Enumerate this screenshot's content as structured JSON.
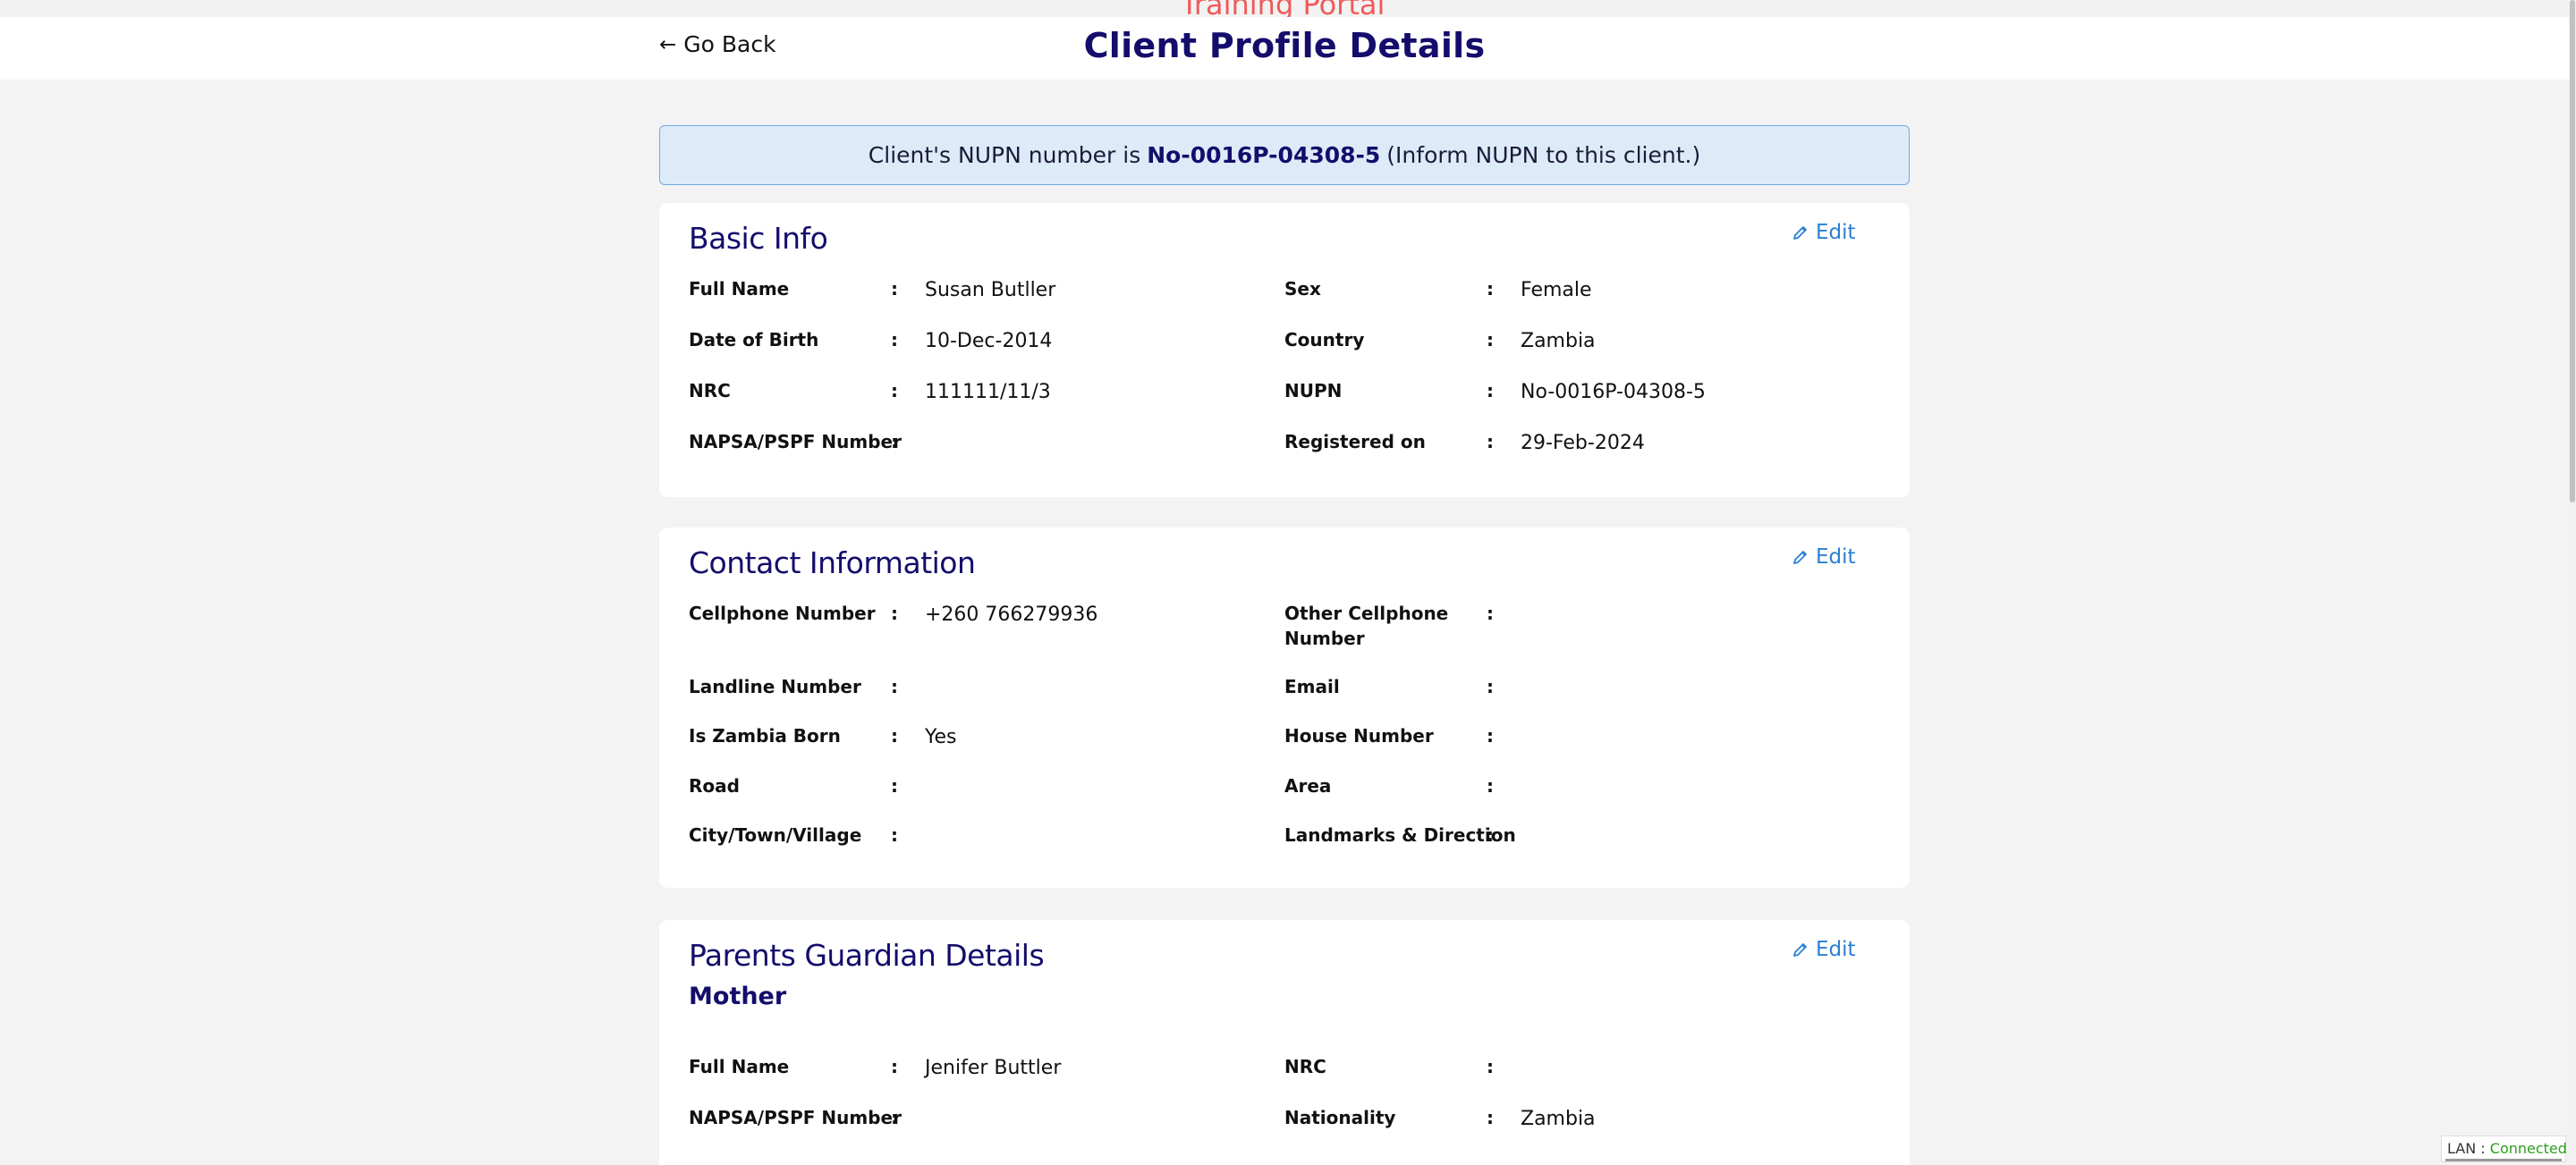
{
  "portal_banner": "Training Portal",
  "header": {
    "go_back": "Go Back",
    "title": "Client Profile Details"
  },
  "nupn_notice": {
    "prefix": "Client's NUPN number is",
    "number": "No-0016P-04308-5",
    "suffix": "(Inform NUPN to this client.)"
  },
  "basic_info": {
    "title": "Basic Info",
    "edit_label": "Edit",
    "fields": {
      "full_name": {
        "label": "Full Name",
        "value": "Susan Butller"
      },
      "sex": {
        "label": "Sex",
        "value": "Female"
      },
      "dob": {
        "label": "Date of Birth",
        "value": "10-Dec-2014"
      },
      "country": {
        "label": "Country",
        "value": "Zambia"
      },
      "nrc": {
        "label": "NRC",
        "value": "111111/11/3"
      },
      "nupn": {
        "label": "NUPN",
        "value": "No-0016P-04308-5"
      },
      "napsa": {
        "label": "NAPSA/PSPF Number",
        "value": ""
      },
      "registered": {
        "label": "Registered on",
        "value": "29-Feb-2024"
      }
    }
  },
  "contact_info": {
    "title": "Contact Information",
    "edit_label": "Edit",
    "fields": {
      "cellphone": {
        "label": "Cellphone Number",
        "value": "+260 766279936"
      },
      "other_cell_1": {
        "label": "Other Cellphone",
        "value": ""
      },
      "other_cell_2": {
        "label": "Number"
      },
      "landline": {
        "label": "Landline Number",
        "value": ""
      },
      "email": {
        "label": "Email",
        "value": ""
      },
      "zambia_born": {
        "label": "Is Zambia Born",
        "value": "Yes"
      },
      "house_number": {
        "label": "House Number",
        "value": ""
      },
      "road": {
        "label": "Road",
        "value": ""
      },
      "area": {
        "label": "Area",
        "value": ""
      },
      "city": {
        "label": "City/Town/Village",
        "value": ""
      },
      "landmarks": {
        "label": "Landmarks & Direction",
        "value": ""
      }
    }
  },
  "parents": {
    "title": "Parents Guardian Details",
    "subtitle": "Mother",
    "edit_label": "Edit",
    "fields": {
      "full_name": {
        "label": "Full Name",
        "value": "Jenifer Buttler"
      },
      "nrc": {
        "label": "NRC",
        "value": ""
      },
      "napsa": {
        "label": "NAPSA/PSPF Number",
        "value": ""
      },
      "nationality": {
        "label": "Nationality",
        "value": "Zambia"
      }
    }
  },
  "status": {
    "lan_label": "LAN :",
    "lan_value": "Connected"
  },
  "colon": ":"
}
